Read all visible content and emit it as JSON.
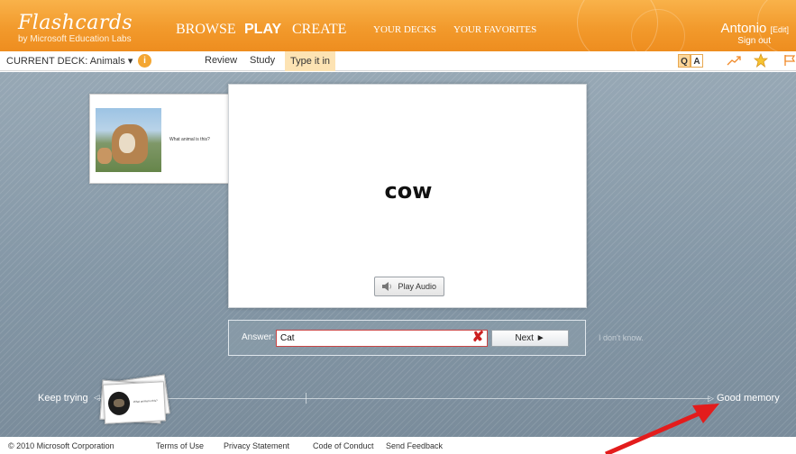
{
  "app": {
    "title": "Flashcards",
    "subtitle": "by Microsoft Education Labs"
  },
  "nav": {
    "browse": "BROWSE",
    "play": "PLAY",
    "create": "CREATE",
    "your_decks": "YOUR DECKS",
    "your_favorites": "YOUR FAVORITES"
  },
  "user": {
    "name": "Antonio",
    "edit": "[Edit]",
    "sign_out": "Sign out"
  },
  "subbar": {
    "deck_label": "CURRENT DECK:",
    "deck_value": "Animals",
    "dropdown_glyph": "▾",
    "info_glyph": "i",
    "modes": [
      "Review",
      "Study",
      "Type it in"
    ],
    "active_mode": "Type it in",
    "q_label": "Q",
    "a_label": "A"
  },
  "card": {
    "question_text": "What animal is this?",
    "answer_word": "cow",
    "play_audio_label": "Play Audio"
  },
  "answer": {
    "label": "Answer:",
    "value": "Cat",
    "clear_glyph": "✘",
    "next_label": "Next ►",
    "dont_know": "I don't know."
  },
  "progress": {
    "left_label": "Keep trying",
    "right_label": "Good memory",
    "left_arrow": "◁",
    "right_arrow": "▷"
  },
  "footer": {
    "copyright": "© 2010 Microsoft Corporation",
    "links": [
      "Terms of Use",
      "Privacy Statement",
      "Code of Conduct",
      "Send Feedback"
    ]
  },
  "colors": {
    "brand_orange": "#f29a2c",
    "accent_red": "#e31c1c",
    "stage": "#8497a6"
  },
  "icons": [
    "speaker-icon",
    "clear-x-icon",
    "trend-icon",
    "star-icon",
    "flag-icon",
    "info-icon",
    "dropdown-arrow-icon",
    "red-arrow-annotation-icon"
  ]
}
